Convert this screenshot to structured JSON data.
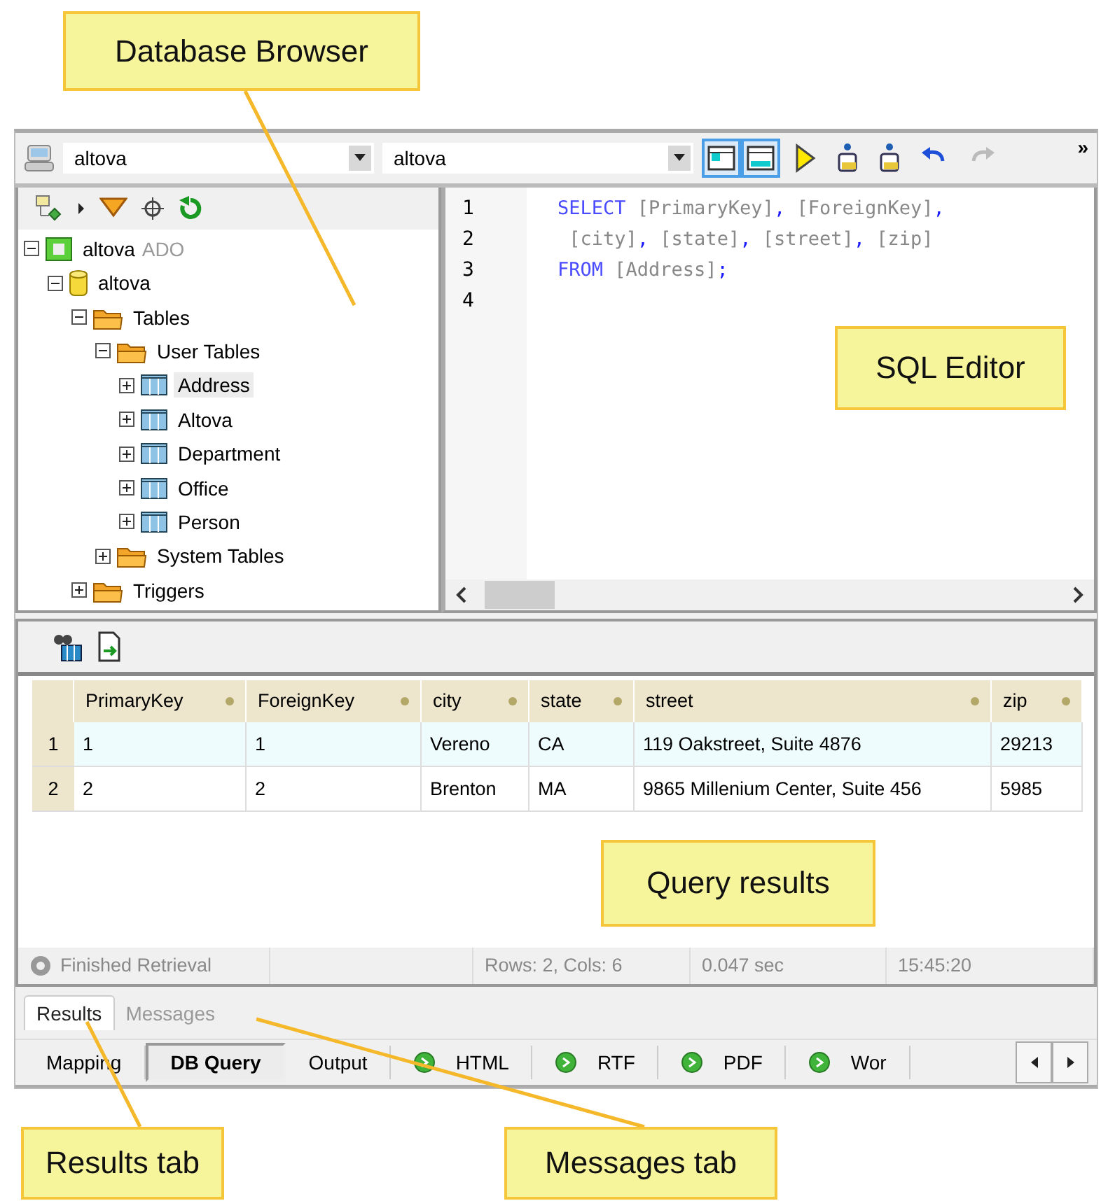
{
  "callouts": [
    {
      "text": "Database Browser"
    },
    {
      "text": "SQL Editor"
    },
    {
      "text": "Query results"
    },
    {
      "text": "Results tab"
    },
    {
      "text": "Messages tab"
    }
  ],
  "toolbar": {
    "connection": "altova",
    "database": "altova",
    "layout_toggles": [
      {
        "selected": true
      },
      {
        "selected": true
      }
    ],
    "overflow": "»"
  },
  "tree": [
    {
      "label": "altova",
      "suffix": "ADO",
      "kind": "connection",
      "expanded": true,
      "selected": false,
      "children": [
        {
          "label": "altova",
          "kind": "database",
          "expanded": true,
          "selected": false,
          "children": [
            {
              "label": "Tables",
              "kind": "folder",
              "expanded": true,
              "selected": false,
              "children": [
                {
                  "label": "User Tables",
                  "kind": "folder",
                  "expanded": true,
                  "selected": false,
                  "children": [
                    {
                      "label": "Address",
                      "kind": "table",
                      "expanded": false,
                      "selected": true
                    },
                    {
                      "label": "Altova",
                      "kind": "table",
                      "expanded": false,
                      "selected": false
                    },
                    {
                      "label": "Department",
                      "kind": "table",
                      "expanded": false,
                      "selected": false
                    },
                    {
                      "label": "Office",
                      "kind": "table",
                      "expanded": false,
                      "selected": false
                    },
                    {
                      "label": "Person",
                      "kind": "table",
                      "expanded": false,
                      "selected": false
                    }
                  ]
                },
                {
                  "label": "System Tables",
                  "kind": "folder",
                  "expanded": false,
                  "selected": false
                }
              ]
            },
            {
              "label": "Triggers",
              "kind": "folder",
              "expanded": false,
              "selected": false
            }
          ]
        }
      ]
    }
  ],
  "editor": {
    "line_numbers": [
      "1",
      "2",
      "3",
      "4"
    ],
    "lines": [
      [
        {
          "kind": "keyword",
          "text": "SELECT"
        },
        {
          "kind": "ident",
          "text": " [PrimaryKey]"
        },
        {
          "kind": "punct",
          "text": ","
        },
        {
          "kind": "ident",
          "text": " [ForeignKey]"
        },
        {
          "kind": "punct",
          "text": ","
        }
      ],
      [
        {
          "kind": "ident",
          "text": " [city]"
        },
        {
          "kind": "punct",
          "text": ","
        },
        {
          "kind": "ident",
          "text": " [state]"
        },
        {
          "kind": "punct",
          "text": ","
        },
        {
          "kind": "ident",
          "text": " [street]"
        },
        {
          "kind": "punct",
          "text": ","
        },
        {
          "kind": "ident",
          "text": " [zip]"
        }
      ],
      [
        {
          "kind": "keyword",
          "text": "FROM"
        },
        {
          "kind": "ident",
          "text": " [Address]"
        },
        {
          "kind": "punct",
          "text": ";"
        }
      ]
    ]
  },
  "results": {
    "columns": [
      "PrimaryKey",
      "ForeignKey",
      "city",
      "state",
      "street",
      "zip"
    ],
    "rows": [
      {
        "number": "1",
        "selected": true,
        "cells": [
          "1",
          "1",
          "Vereno",
          "CA",
          "119 Oakstreet, Suite 4876",
          "29213"
        ]
      },
      {
        "number": "2",
        "selected": false,
        "cells": [
          "2",
          "2",
          "Brenton",
          "MA",
          "9865 Millenium Center, Suite 456",
          "5985"
        ]
      }
    ],
    "status": {
      "message": "Finished Retrieval",
      "counts": "Rows: 2, Cols: 6",
      "duration": "0.047 sec",
      "time": "15:45:20"
    }
  },
  "result_tabs": [
    {
      "label": "Results",
      "selected": true
    },
    {
      "label": "Messages",
      "selected": false
    }
  ],
  "view_tabs": [
    {
      "label": "Mapping",
      "kind": "plain",
      "selected": false
    },
    {
      "label": "DB Query",
      "kind": "plain",
      "selected": true
    },
    {
      "label": "Output",
      "kind": "plain",
      "selected": false
    },
    {
      "label": "HTML",
      "kind": "output",
      "selected": false
    },
    {
      "label": "RTF",
      "kind": "output",
      "selected": false
    },
    {
      "label": "PDF",
      "kind": "output",
      "selected": false
    },
    {
      "label": "Wor",
      "kind": "output",
      "selected": false
    }
  ]
}
